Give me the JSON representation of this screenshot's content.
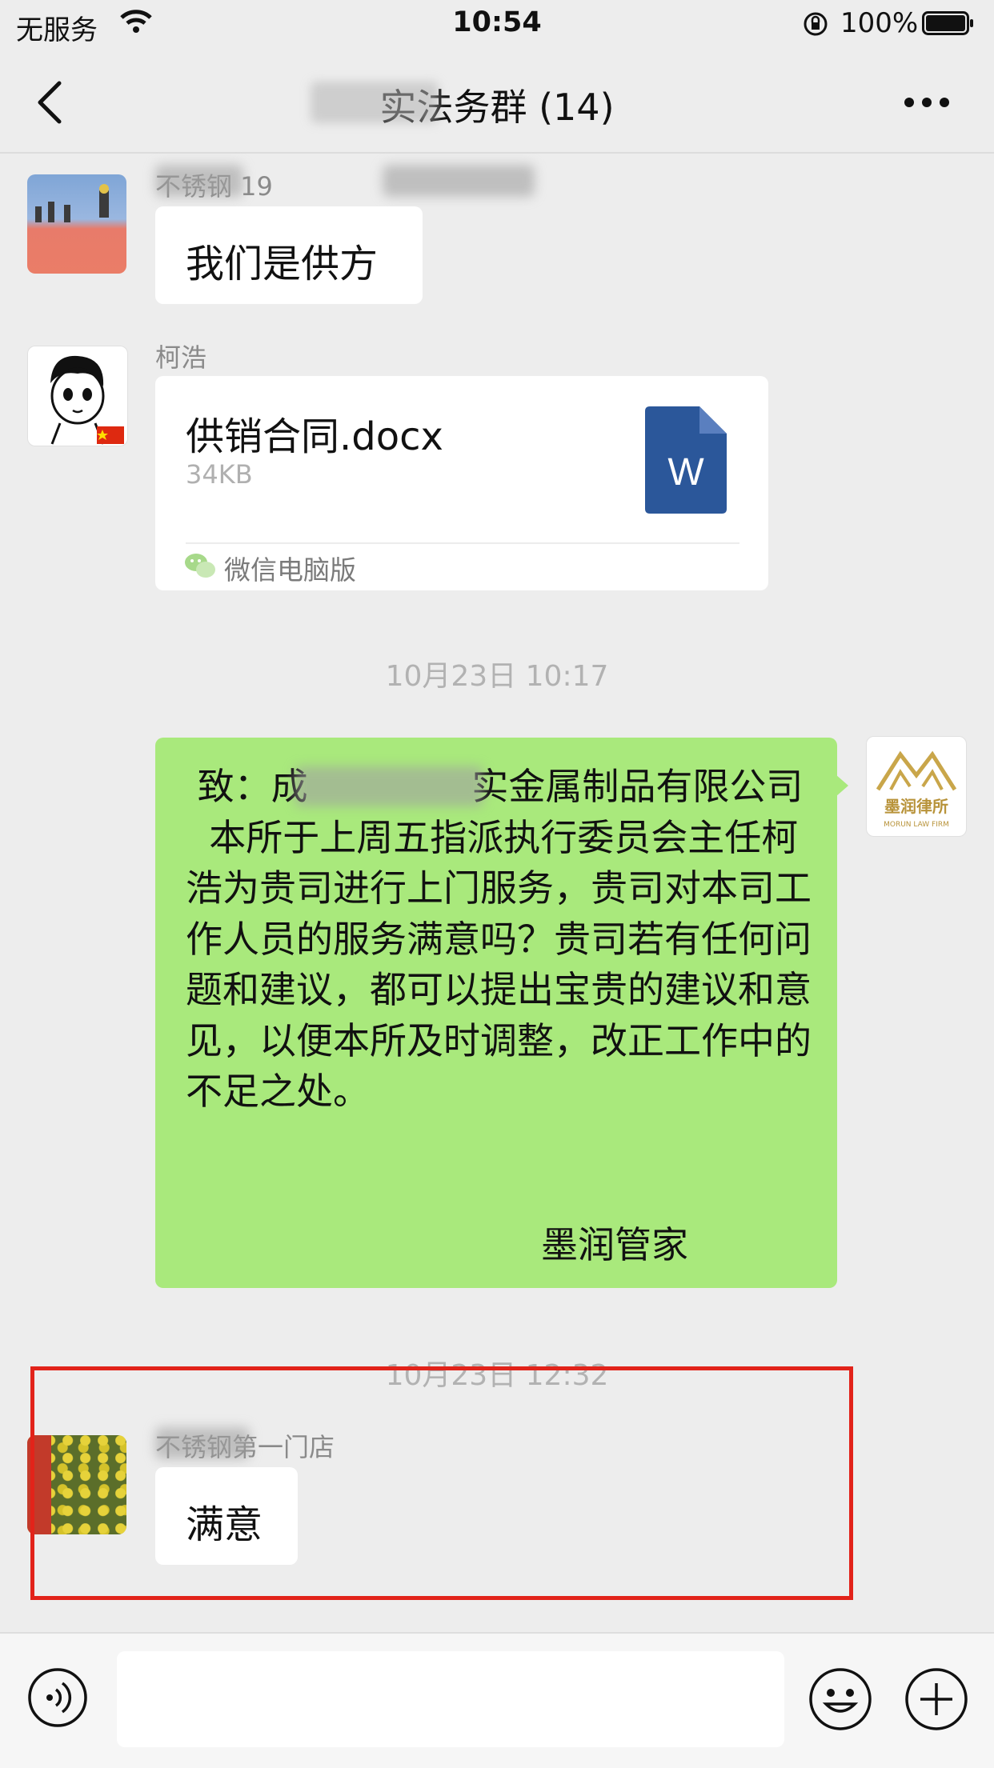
{
  "status_bar": {
    "carrier": "无服务",
    "time": "10:54",
    "battery": "100%"
  },
  "nav": {
    "title": "实法务群 (14)"
  },
  "messages": [
    {
      "sender": "不锈钢 19",
      "text": "我们是供方",
      "avatar_icon": "beach-wall-avatar"
    },
    {
      "sender": "柯浩",
      "file": {
        "name": "供销合同.docx",
        "size": "34KB",
        "icon": "word-document-icon",
        "source": "微信电脑版"
      },
      "avatar_icon": "cartoon-boy-avatar"
    },
    {
      "timestamp": "10月23日 10:17"
    },
    {
      "text": " 致：成              实金属制品有限公司\n  本所于上周五指派执行委员会主任柯浩为贵司进行上门服务，贵司对本司工作人员的服务满意吗？贵司若有任何问题和建议，都可以提出宝贵的建议和意见，以便本所及时调整，改正工作中的不足之处。",
      "signature": "墨润管家",
      "avatar_label": "墨润律所",
      "avatar_sub": "MORUN LAW FIRM",
      "bubble_color": "#a9e97c"
    },
    {
      "timestamp": "10月23日 12:32"
    },
    {
      "sender": "不锈钢第一门店",
      "text": "满意",
      "avatar_icon": "yellow-flowers-avatar"
    }
  ],
  "colors": {
    "background": "#ededed",
    "sent_bubble": "#a9e97c",
    "highlight": "#e2231a",
    "word_blue": "#2b579a"
  }
}
